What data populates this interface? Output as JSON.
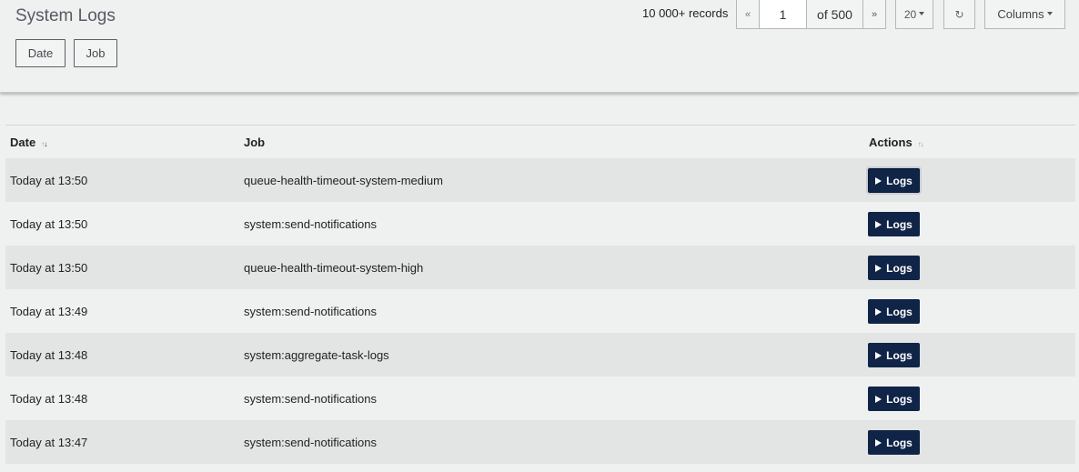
{
  "header": {
    "title": "System Logs",
    "filters": [
      "Date",
      "Job"
    ],
    "records": "10 000+ records",
    "pagination": {
      "first": "«",
      "current_page": "1",
      "of_label": "of 500",
      "next": "»",
      "page_size": "20",
      "refresh": "↻",
      "columns": "Columns"
    }
  },
  "table": {
    "columns": [
      "Date",
      "Job",
      "Actions"
    ],
    "rows": [
      {
        "date": "Today at 13:50",
        "job": "queue-health-timeout-system-medium",
        "action": "Logs"
      },
      {
        "date": "Today at 13:50",
        "job": "system:send-notifications",
        "action": "Logs"
      },
      {
        "date": "Today at 13:50",
        "job": "queue-health-timeout-system-high",
        "action": "Logs"
      },
      {
        "date": "Today at 13:49",
        "job": "system:send-notifications",
        "action": "Logs"
      },
      {
        "date": "Today at 13:48",
        "job": "system:aggregate-task-logs",
        "action": "Logs"
      },
      {
        "date": "Today at 13:48",
        "job": "system:send-notifications",
        "action": "Logs"
      },
      {
        "date": "Today at 13:47",
        "job": "system:send-notifications",
        "action": "Logs"
      }
    ]
  },
  "colors": {
    "background": "#eff0f0",
    "row_alt": "#e3e4e4",
    "button_primary": "#102447"
  }
}
